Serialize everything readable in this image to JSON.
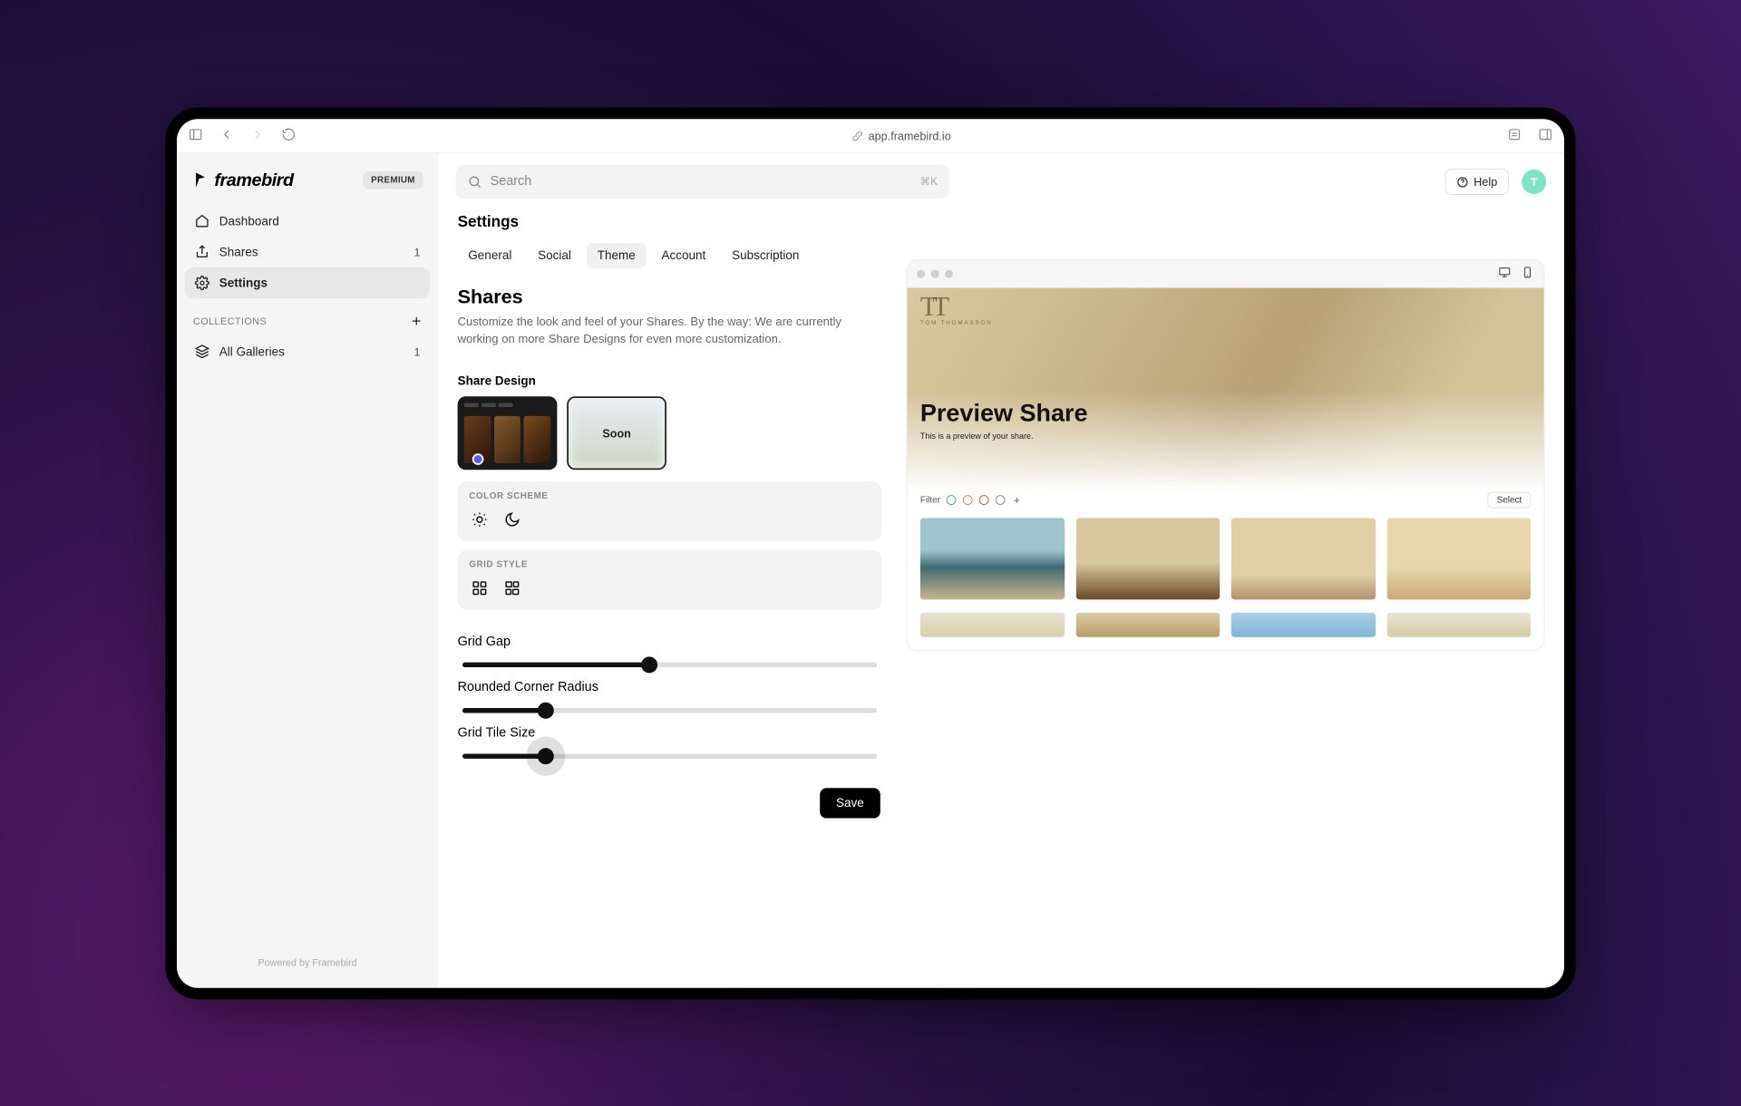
{
  "browser": {
    "url": "app.framebird.io"
  },
  "brand": {
    "name": "framebird",
    "badge": "PREMIUM"
  },
  "sidebar": {
    "items": [
      {
        "label": "Dashboard"
      },
      {
        "label": "Shares",
        "count": "1"
      },
      {
        "label": "Settings"
      }
    ],
    "collections_header": "COLLECTIONS",
    "collections": [
      {
        "label": "All Galleries",
        "count": "1"
      }
    ],
    "footer": "Powered by Framebird"
  },
  "topbar": {
    "search_placeholder": "Search",
    "shortcut": "⌘K",
    "help_label": "Help",
    "avatar_initial": "T"
  },
  "settings": {
    "page_title": "Settings",
    "tabs": [
      "General",
      "Social",
      "Theme",
      "Account",
      "Subscription"
    ],
    "active_tab": "Theme",
    "shares": {
      "title": "Shares",
      "description": "Customize the look and feel of your Shares. By the way: We are currently working on more Share Designs for even more customization.",
      "design_label": "Share Design",
      "soon_label": "Soon",
      "color_scheme_label": "COLOR SCHEME",
      "grid_style_label": "GRID STYLE",
      "sliders": {
        "grid_gap": {
          "label": "Grid Gap",
          "value_pct": 45
        },
        "radius": {
          "label": "Rounded Corner Radius",
          "value_pct": 20
        },
        "tile_size": {
          "label": "Grid Tile Size",
          "value_pct": 20,
          "focused": true
        }
      },
      "save_label": "Save"
    }
  },
  "preview": {
    "brand_monogram": "TT",
    "brand_sub": "TOM THOMASSON",
    "title": "Preview Share",
    "subtitle": "This is a preview of your share.",
    "filter_label": "Filter",
    "filter_colors": [
      "#3cb371",
      "#e07a3a",
      "#d94a36",
      "#888888"
    ],
    "select_label": "Select"
  }
}
